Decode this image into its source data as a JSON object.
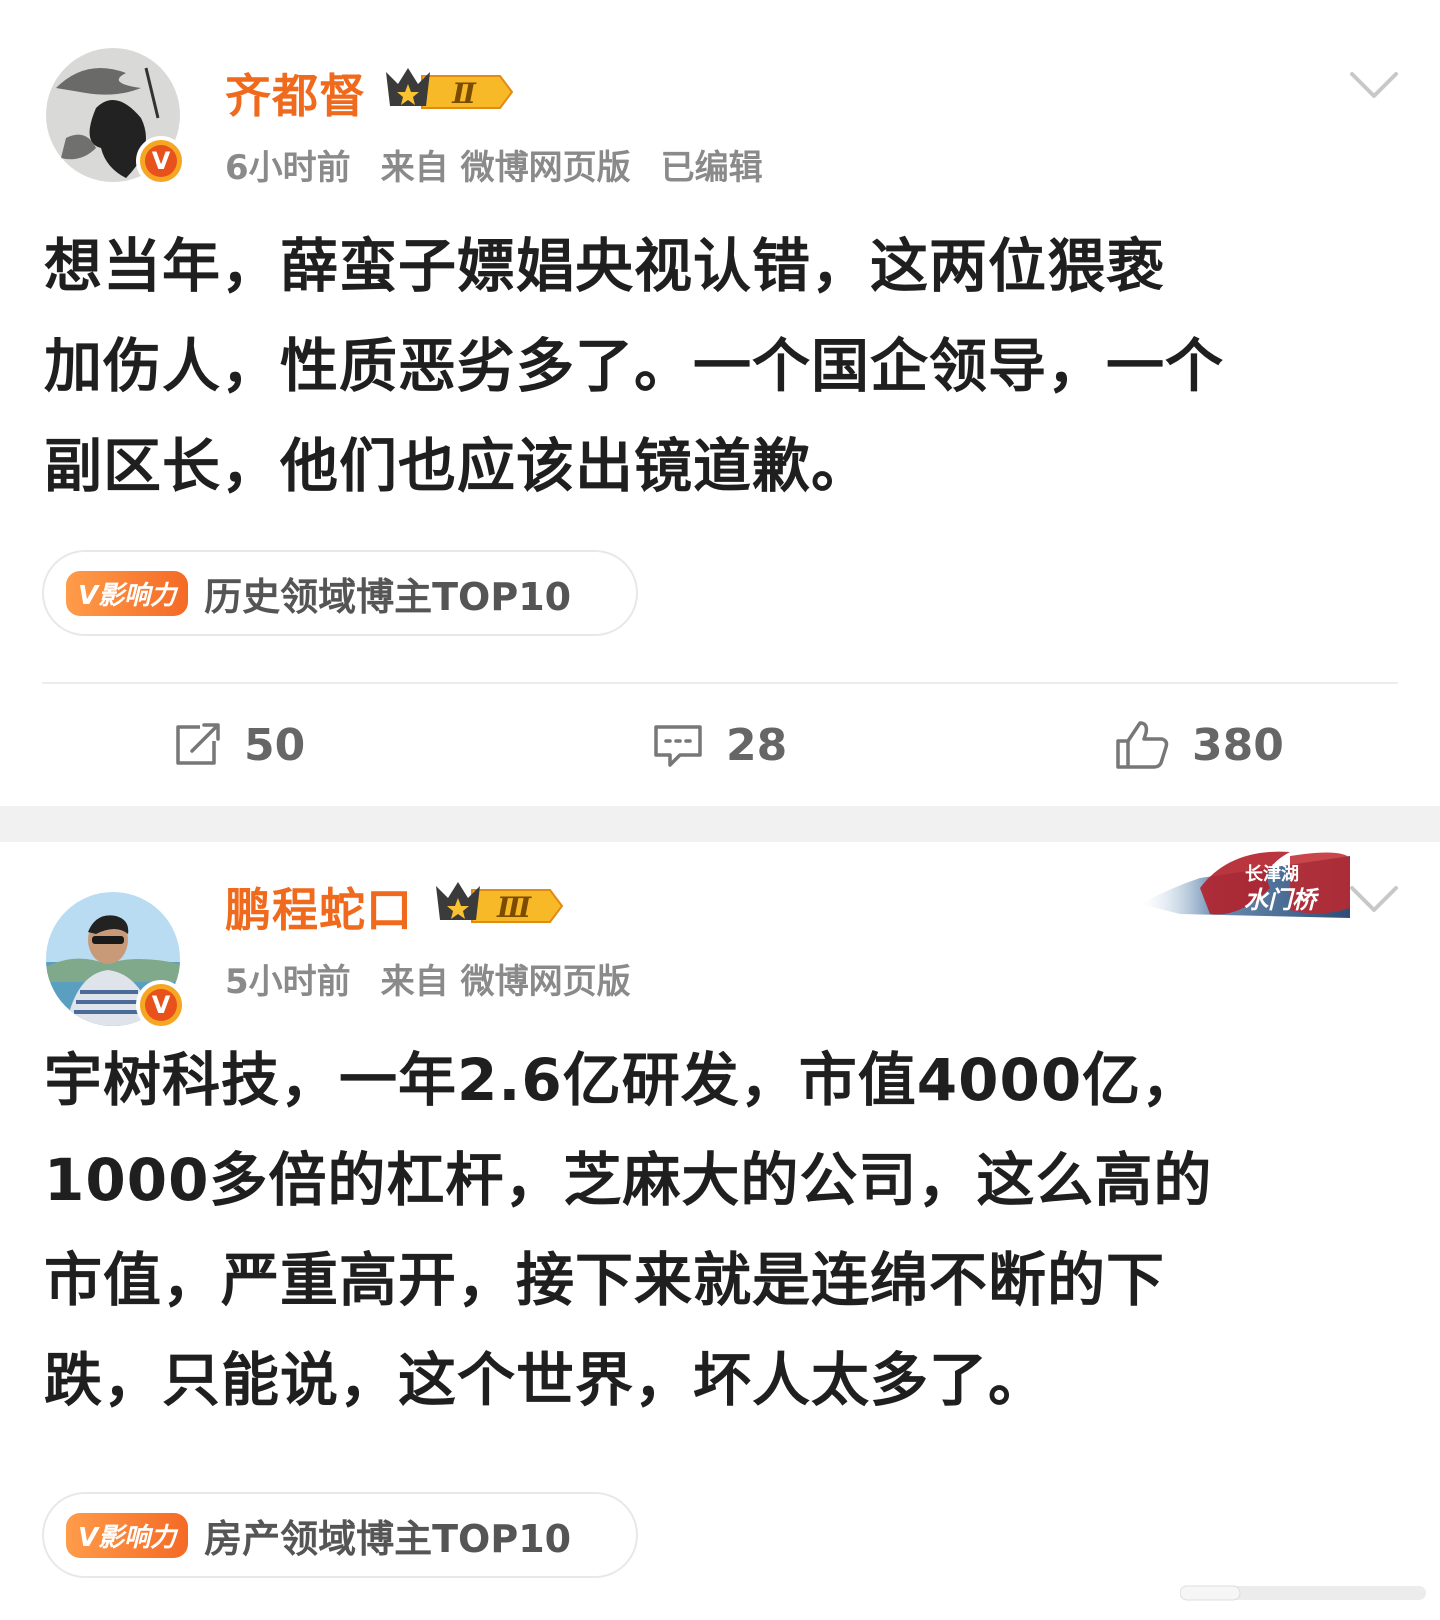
{
  "posts": [
    {
      "username": "齐都督",
      "level": "Ⅱ",
      "time": "6小时前",
      "source_prefix": "来自",
      "source": "微博网页版",
      "edited": "已编辑",
      "content_lines": [
        "想当年，薛蛮子嫖娼央视认错，这两位猥亵",
        "加伤人，性质恶劣多了。一个国企领导，一个",
        "副区长，他们也应该出镜道歉。"
      ],
      "influence_badge": "V影响力",
      "influence_text": "历史领域博主TOP10",
      "actions": {
        "repost": "50",
        "comment": "28",
        "like": "380"
      }
    },
    {
      "username": "鹏程蛇口",
      "level": "Ⅲ",
      "time": "5小时前",
      "source_prefix": "来自",
      "source": "微博网页版",
      "content_lines": [
        "宇树科技，一年2.6亿研发，市值4000亿，",
        "1000多倍的杠杆，芝麻大的公司，这么高的",
        "市值，严重高开，接下来就是连绵不断的下",
        "跌，只能说，这个世界，坏人太多了。"
      ],
      "influence_badge": "V影响力",
      "influence_text": "房产领域博主TOP10",
      "event_banner": "长津湖 水门桥"
    }
  ],
  "icons": {
    "repost": "repost-icon",
    "comment": "comment-icon",
    "like": "like-icon",
    "more": "chevron-down-icon",
    "verified": "verified-badge-icon",
    "crown": "crown-icon"
  },
  "colors": {
    "username": "#f06a1d",
    "meta": "#8a8a8a",
    "verified": "#f5a623",
    "separator": "#f1f1f1"
  }
}
